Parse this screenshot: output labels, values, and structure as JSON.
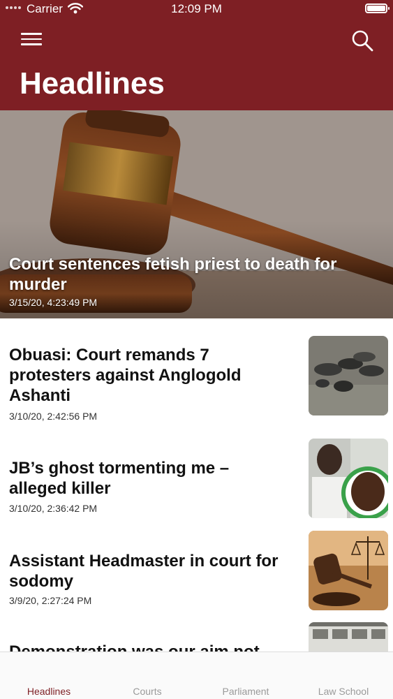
{
  "status_bar": {
    "carrier": "Carrier",
    "time": "12:09 PM"
  },
  "header": {
    "title": "Headlines",
    "color": "#7e1f24"
  },
  "hero": {
    "title": "Court sentences fetish priest to death for murder",
    "date": "3/15/20, 4:23:49 PM"
  },
  "articles": [
    {
      "title": "Obuasi: Court remands 7 protesters against Anglogold Ashanti",
      "date": "3/10/20, 2:42:56 PM"
    },
    {
      "title": "JB’s ghost tormenting me – alleged killer",
      "date": "3/10/20, 2:36:42 PM"
    },
    {
      "title": "Assistant Headmaster in court for sodomy",
      "date": "3/9/20, 2:27:24 PM"
    },
    {
      "title": "Demonstration was our aim not",
      "date": ""
    }
  ],
  "tabs": [
    {
      "label": "Headlines",
      "active": true
    },
    {
      "label": "Courts",
      "active": false
    },
    {
      "label": "Parliament",
      "active": false
    },
    {
      "label": "Law School",
      "active": false
    }
  ]
}
